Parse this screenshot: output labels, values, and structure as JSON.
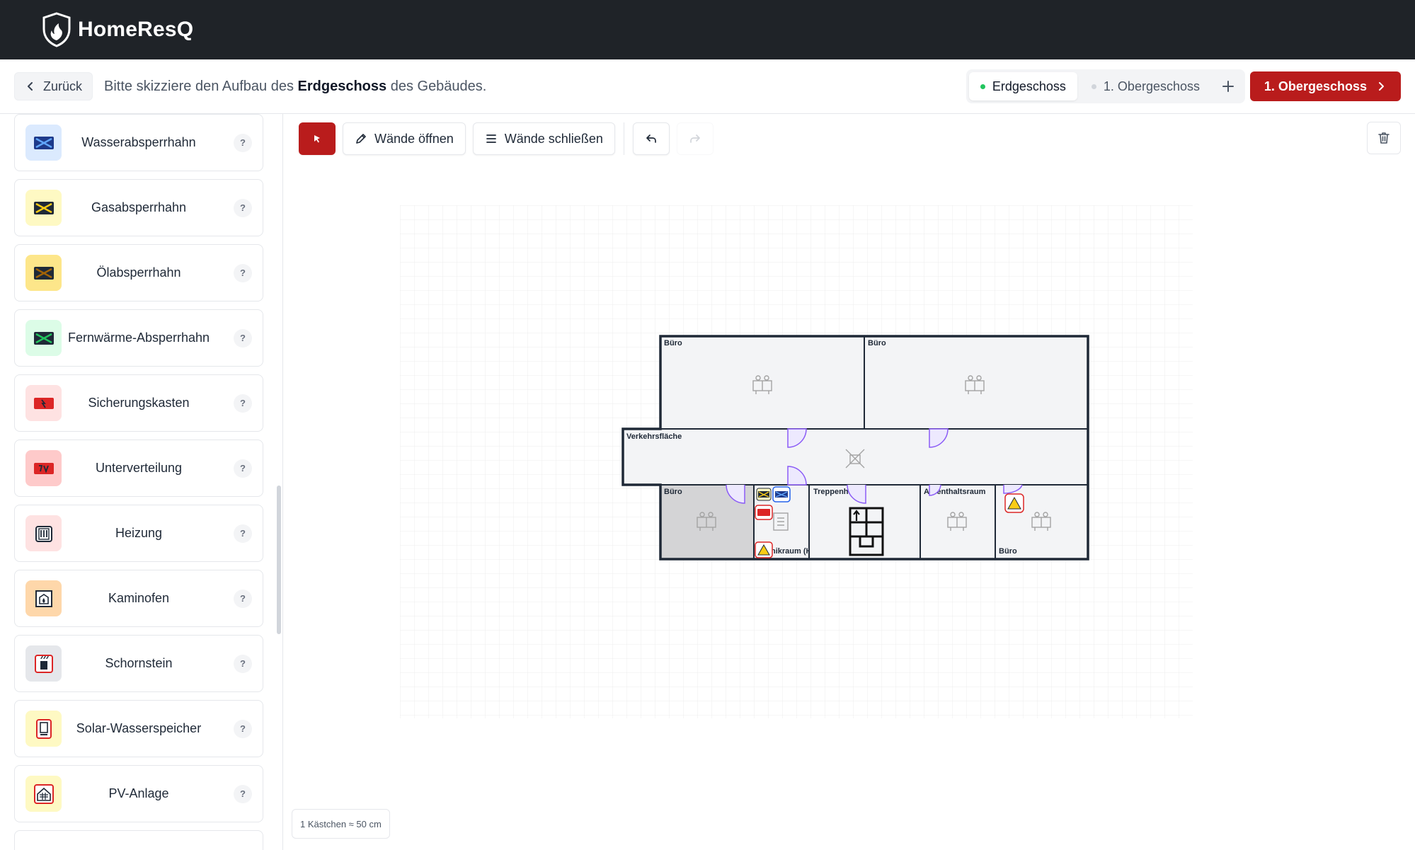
{
  "app": {
    "name": "HomeResQ"
  },
  "header": {
    "back_label": "Zurück",
    "instruction_prefix": "Bitte skizziere den Aufbau des",
    "instruction_floor": "Erdgeschoss",
    "instruction_suffix": "des Gebäudes.",
    "floor_tabs": [
      {
        "label": "Erdgeschoss",
        "active": true,
        "dot_color": "#22c55e"
      },
      {
        "label": "1. Obergeschoss",
        "active": false,
        "dot_color": "#d1d5db"
      }
    ],
    "add_floor_icon": "plus-icon",
    "next_label": "1. Obergeschoss",
    "accent_color": "#b91c1c"
  },
  "sidebar": {
    "items": [
      {
        "label": "Wasserabsperrhahn",
        "icon": "water-valve-icon",
        "bg": "#dbeafe",
        "help": "?"
      },
      {
        "label": "Gasabsperrhahn",
        "icon": "gas-valve-icon",
        "bg": "#fef9c3",
        "help": "?"
      },
      {
        "label": "Ölabsperrhahn",
        "icon": "oil-valve-icon",
        "bg": "#fde68a",
        "help": "?"
      },
      {
        "label": "Fernwärme-Absperrhahn",
        "icon": "district-heating-valve-icon",
        "bg": "#dcfce7",
        "help": "?"
      },
      {
        "label": "Sicherungskasten",
        "icon": "fuse-box-icon",
        "bg": "#fee2e2",
        "help": "?"
      },
      {
        "label": "Unterverteilung",
        "icon": "sub-distribution-icon",
        "bg": "#fecaca",
        "help": "?"
      },
      {
        "label": "Heizung",
        "icon": "heating-icon",
        "bg": "#fee2e2",
        "help": "?"
      },
      {
        "label": "Kaminofen",
        "icon": "stove-icon",
        "bg": "#fed7aa",
        "help": "?"
      },
      {
        "label": "Schornstein",
        "icon": "chimney-icon",
        "bg": "#e5e7eb",
        "help": "?"
      },
      {
        "label": "Solar-Wasserspeicher",
        "icon": "solar-water-tank-icon",
        "bg": "#fef9c3",
        "help": "?"
      },
      {
        "label": "PV-Anlage",
        "icon": "pv-system-icon",
        "bg": "#fef9c3",
        "help": "?"
      }
    ]
  },
  "toolbar": {
    "open_walls_label": "Wände öffnen",
    "close_walls_label": "Wände schließen"
  },
  "plan": {
    "rooms": [
      "Büro",
      "Büro",
      "Verkehrsfläche",
      "Büro",
      "Treppenhaus",
      "Aufenthaltsraum",
      "Büro",
      "nikraum (HAR)"
    ]
  },
  "scale_note": "1 Kästchen ≈ 50 cm"
}
